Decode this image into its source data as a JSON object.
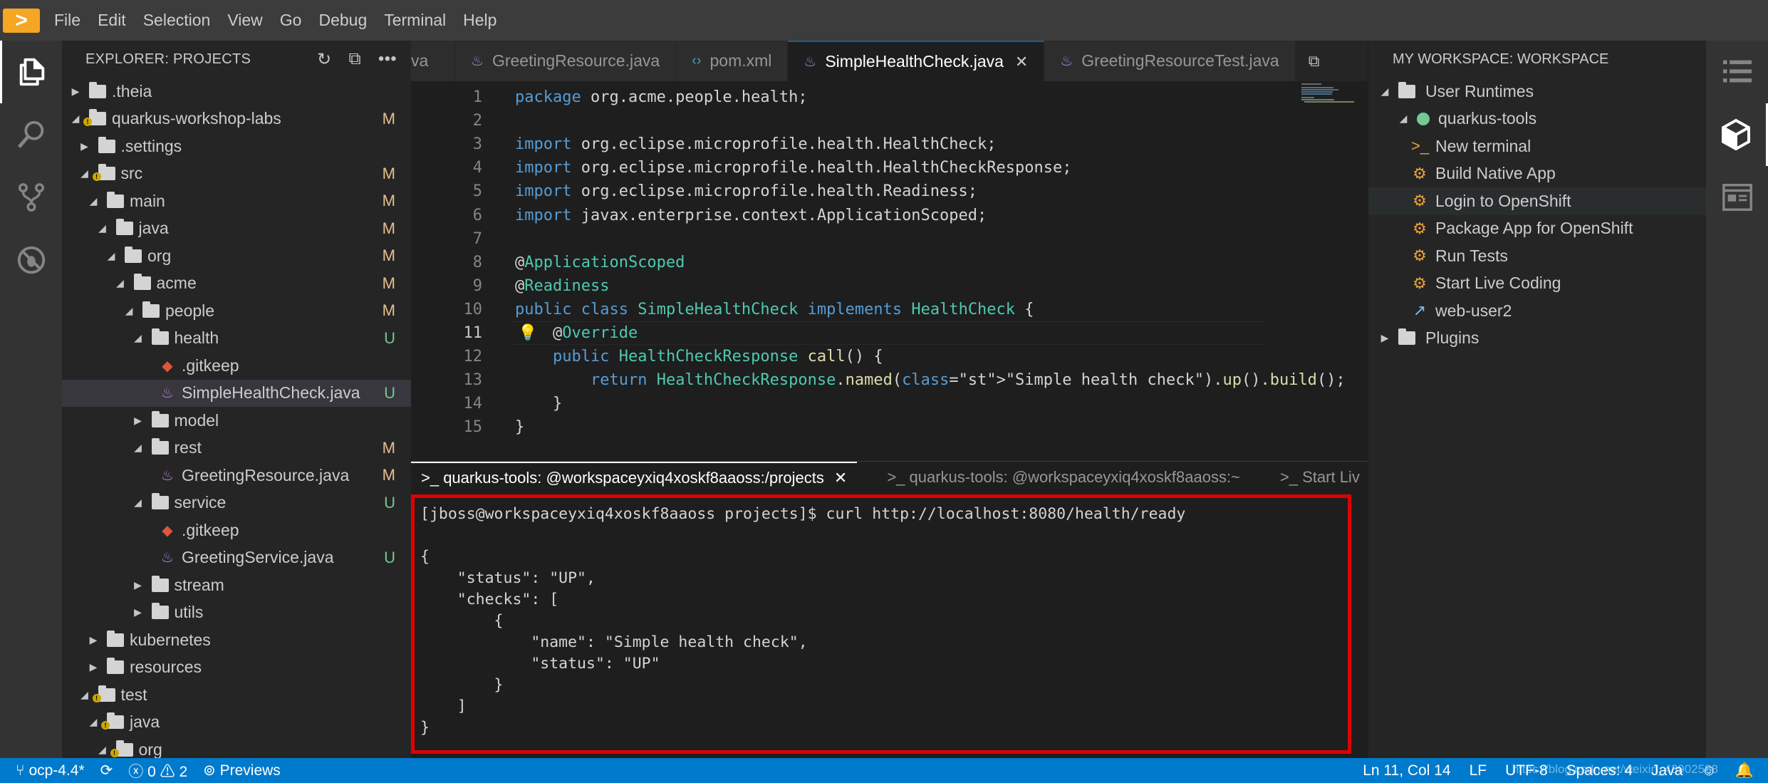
{
  "menubar": {
    "logo": ">",
    "items": [
      "File",
      "Edit",
      "Selection",
      "View",
      "Go",
      "Debug",
      "Terminal",
      "Help"
    ]
  },
  "explorer": {
    "title": "EXPLORER: PROJECTS",
    "tree": [
      {
        "label": ".theia",
        "badge": ""
      },
      {
        "label": "quarkus-workshop-labs",
        "badge": "M"
      },
      {
        "label": ".settings",
        "badge": ""
      },
      {
        "label": "src",
        "badge": "M"
      },
      {
        "label": "main",
        "badge": "M"
      },
      {
        "label": "java",
        "badge": "M"
      },
      {
        "label": "org",
        "badge": "M"
      },
      {
        "label": "acme",
        "badge": "M"
      },
      {
        "label": "people",
        "badge": "M"
      },
      {
        "label": "health",
        "badge": "U"
      },
      {
        "label": ".gitkeep",
        "badge": ""
      },
      {
        "label": "SimpleHealthCheck.java",
        "badge": "U"
      },
      {
        "label": "model",
        "badge": ""
      },
      {
        "label": "rest",
        "badge": "M"
      },
      {
        "label": "GreetingResource.java",
        "badge": "M"
      },
      {
        "label": "service",
        "badge": "U"
      },
      {
        "label": ".gitkeep",
        "badge": ""
      },
      {
        "label": "GreetingService.java",
        "badge": "U"
      },
      {
        "label": "stream",
        "badge": ""
      },
      {
        "label": "utils",
        "badge": ""
      },
      {
        "label": "kubernetes",
        "badge": ""
      },
      {
        "label": "resources",
        "badge": ""
      },
      {
        "label": "test",
        "badge": ""
      },
      {
        "label": "java",
        "badge": ""
      },
      {
        "label": "org",
        "badge": ""
      }
    ]
  },
  "editor": {
    "tabs": [
      {
        "label": "va"
      },
      {
        "label": "GreetingResource.java"
      },
      {
        "label": "pom.xml"
      },
      {
        "label": "SimpleHealthCheck.java"
      },
      {
        "label": "GreetingResourceTest.java"
      }
    ],
    "lines": [
      "package org.acme.people.health;",
      "",
      "import org.eclipse.microprofile.health.HealthCheck;",
      "import org.eclipse.microprofile.health.HealthCheckResponse;",
      "import org.eclipse.microprofile.health.Readiness;",
      "import javax.enterprise.context.ApplicationScoped;",
      "",
      "@ApplicationScoped",
      "@Readiness",
      "public class SimpleHealthCheck implements HealthCheck {",
      "    @Override",
      "    public HealthCheckResponse call() {",
      "        return HealthCheckResponse.named(\"Simple health check\").up().build();",
      "    }",
      "}"
    ],
    "line_numbers": [
      "1",
      "2",
      "3",
      "4",
      "5",
      "6",
      "7",
      "8",
      "9",
      "10",
      "11",
      "12",
      "13",
      "14",
      "15"
    ]
  },
  "terminal": {
    "tabs": [
      {
        "label": ">_ quarkus-tools: @workspaceyxiq4xoskf8aaoss:/projects"
      },
      {
        "label": ">_ quarkus-tools: @workspaceyxiq4xoskf8aaoss:~"
      },
      {
        "label": ">_ Start Liv"
      }
    ],
    "lines": [
      "[jboss@workspaceyxiq4xoskf8aaoss projects]$ curl http://localhost:8080/health/ready",
      "",
      "{",
      "    \"status\": \"UP\",",
      "    \"checks\": [",
      "        {",
      "            \"name\": \"Simple health check\",",
      "            \"status\": \"UP\"",
      "        }",
      "    ]",
      "}"
    ]
  },
  "workspace": {
    "title": "MY WORKSPACE: WORKSPACE",
    "items": [
      {
        "label": "User Runtimes"
      },
      {
        "label": "quarkus-tools"
      },
      {
        "label": "New terminal"
      },
      {
        "label": "Build Native App"
      },
      {
        "label": "Login to OpenShift"
      },
      {
        "label": "Package App for OpenShift"
      },
      {
        "label": "Run Tests"
      },
      {
        "label": "Start Live Coding"
      },
      {
        "label": "web-user2"
      },
      {
        "label": "Plugins"
      }
    ]
  },
  "statusbar": {
    "branch": "ocp-4.4*",
    "errors": "0",
    "warnings": "2",
    "previews": "Previews",
    "position": "Ln 11, Col 14",
    "eol": "LF",
    "encoding": "UTF-8",
    "spaces": "Spaces: 4",
    "language": "Java",
    "watermark": "https://blog.csdn.net/weixin_43902588"
  },
  "colors": {
    "accent": "#007acc",
    "highlight_border": "#e00000",
    "modified": "#e2c08d",
    "untracked": "#73c991"
  }
}
